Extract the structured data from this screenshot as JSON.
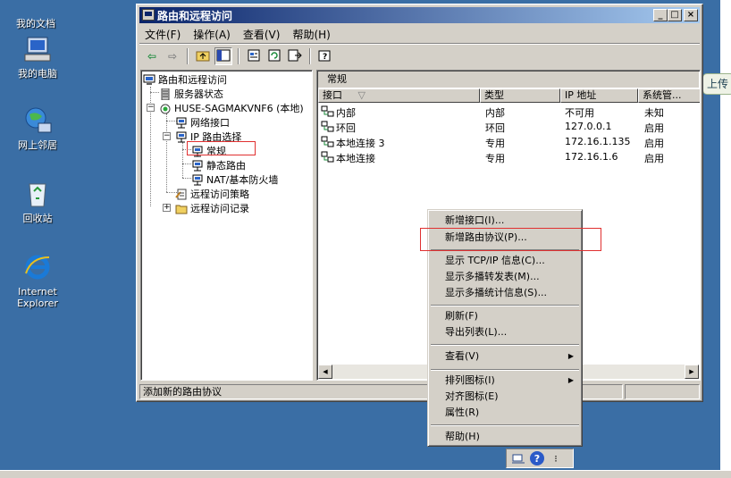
{
  "desktop": {
    "icons": [
      {
        "label": "我的文档"
      },
      {
        "label": "我的电脑"
      },
      {
        "label": "网上邻居"
      },
      {
        "label": "回收站"
      },
      {
        "label": "Internet\nExplorer"
      }
    ]
  },
  "window": {
    "title": "路由和远程访问",
    "controls": {
      "minimize": "_",
      "maximize": "□",
      "close": "×"
    }
  },
  "menubar": {
    "items": [
      {
        "label": "文件(F)"
      },
      {
        "label": "操作(A)"
      },
      {
        "label": "查看(V)"
      },
      {
        "label": "帮助(H)"
      }
    ]
  },
  "toolbar": {
    "icons": [
      "back-arrow-icon",
      "forward-arrow-icon",
      "up-folder-icon",
      "show-hide-tree-icon",
      "properties-icon",
      "refresh-icon",
      "export-list-icon",
      "help-icon"
    ]
  },
  "tree": {
    "root": "路由和远程访问",
    "server_status": "服务器状态",
    "server": "HUSE-SAGMAKVNF6 (本地)",
    "network_interfaces": "网络接口",
    "ip_routing": "IP 路由选择",
    "general": "常规",
    "static_routes": "静态路由",
    "nat_firewall": "NAT/基本防火墙",
    "remote_access_policy": "远程访问策略",
    "remote_access_logging": "远程访问记录",
    "expand_plus": "+",
    "expand_minus": "−"
  },
  "right_pane": {
    "title": "常规",
    "columns": [
      "接口",
      "类型",
      "IP 地址",
      "系统管..."
    ],
    "sort_indicator": "▽",
    "rows": [
      {
        "name": "内部",
        "type": "内部",
        "ip": "不可用",
        "admin": "未知"
      },
      {
        "name": "环回",
        "type": "环回",
        "ip": "127.0.0.1",
        "admin": "启用"
      },
      {
        "name": "本地连接 3",
        "type": "专用",
        "ip": "172.16.1.135",
        "admin": "启用"
      },
      {
        "name": "本地连接",
        "type": "专用",
        "ip": "172.16.1.6",
        "admin": "启用"
      }
    ]
  },
  "statusbar": {
    "text": "添加新的路由协议"
  },
  "context_menu": {
    "items": [
      {
        "label": "新增接口(I)..."
      },
      {
        "label": "新增路由协议(P)..."
      },
      {
        "label": "显示 TCP/IP 信息(C)..."
      },
      {
        "label": "显示多播转发表(M)..."
      },
      {
        "label": "显示多播统计信息(S)..."
      },
      {
        "label": "刷新(F)"
      },
      {
        "label": "导出列表(L)..."
      },
      {
        "label": "查看(V)"
      },
      {
        "label": "排列图标(I)"
      },
      {
        "label": "对齐图标(E)"
      },
      {
        "label": "属性(R)"
      },
      {
        "label": "帮助(H)"
      }
    ],
    "submenu_arrow": "▶"
  },
  "side": {
    "upload_label": "上传"
  },
  "tray": {
    "help_glyph": "?",
    "more_glyph": "⁝"
  },
  "colors": {
    "desktop": "#3a6ea5",
    "title_active": "#0a246a",
    "highlight_box": "#e03030"
  }
}
